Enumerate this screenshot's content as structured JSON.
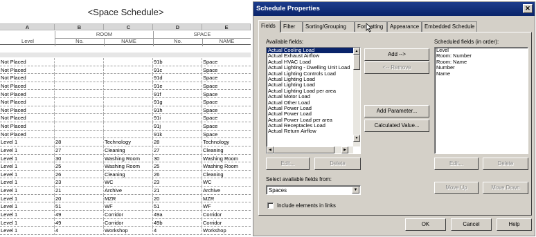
{
  "schedule": {
    "title": "<Space Schedule>",
    "column_letters": [
      "A",
      "B",
      "C",
      "D",
      "E"
    ],
    "group_headers": {
      "room": "ROOM",
      "space": "SPACE"
    },
    "columns": [
      "Level",
      "No.",
      "NAME",
      "No.",
      "NAME"
    ],
    "rows": [
      [
        "Not Placed",
        "",
        "",
        "91b",
        "Space"
      ],
      [
        "Not Placed",
        "",
        "",
        "91c",
        "Space"
      ],
      [
        "Not Placed",
        "",
        "",
        "91d",
        "Space"
      ],
      [
        "Not Placed",
        "",
        "",
        "91e",
        "Space"
      ],
      [
        "Not Placed",
        "",
        "",
        "91f",
        "Space"
      ],
      [
        "Not Placed",
        "",
        "",
        "91g",
        "Space"
      ],
      [
        "Not Placed",
        "",
        "",
        "91h",
        "Space"
      ],
      [
        "Not Placed",
        "",
        "",
        "91i",
        "Space"
      ],
      [
        "Not Placed",
        "",
        "",
        "91j",
        "Space"
      ],
      [
        "Not Placed",
        "",
        "",
        "91k",
        "Space"
      ],
      [
        "Level 1",
        "28",
        "Technology",
        "28",
        "Technology"
      ],
      [
        "Level 1",
        "27",
        "Cleaning",
        "27",
        "Cleaning"
      ],
      [
        "Level 1",
        "30",
        "Washing Room",
        "30",
        "Washing Room"
      ],
      [
        "Level 1",
        "25",
        "Washing Room",
        "25",
        "Washing Room"
      ],
      [
        "Level 1",
        "26",
        "Cleaning",
        "26",
        "Cleaning"
      ],
      [
        "Level 1",
        "23",
        "WC",
        "23",
        "WC"
      ],
      [
        "Level 1",
        "21",
        "Archive",
        "21",
        "Archive"
      ],
      [
        "Level 1",
        "20",
        "MZR",
        "20",
        "MZR"
      ],
      [
        "Level 1",
        "51",
        "WF",
        "51",
        "WF"
      ],
      [
        "Level 1",
        "49",
        "Corridor",
        "49a",
        "Corridor"
      ],
      [
        "Level 1",
        "49",
        "Corridor",
        "49b",
        "Corridor"
      ],
      [
        "Level 1",
        "4",
        "Workshop",
        "4",
        "Workshop"
      ]
    ]
  },
  "dialog": {
    "title": "Schedule Properties",
    "close_icon": "close-icon",
    "tabs": [
      "Fields",
      "Filter",
      "Sorting/Grouping",
      "Formatting",
      "Appearance",
      "Embedded Schedule"
    ],
    "active_tab": "Fields",
    "available_fields_label": "Available fields:",
    "available_fields": [
      "Actual Cooling Load",
      "Actual Exhaust Airflow",
      "Actual HVAC Load",
      "Actual Lighting - Dwelling Unit Load",
      "Actual Lighting Controls Load",
      "Actual Lighting Load",
      "Actual Lighting Load",
      "Actual Lighting Load per area",
      "Actual Motor Load",
      "Actual Other Load",
      "Actual Power Load",
      "Actual Power Load",
      "Actual Power Load per area",
      "Actual Receptacles Load",
      "Actual Return Airflow"
    ],
    "selected_available_field": "Actual Cooling Load",
    "scheduled_fields_label": "Scheduled fields (in order):",
    "scheduled_fields": [
      "Level",
      "Room: Number",
      "Room: Name",
      "Number",
      "Name"
    ],
    "buttons": {
      "add": "Add -->",
      "remove": "<-- Remove",
      "add_parameter": "Add Parameter...",
      "calculated_value": "Calculated Value...",
      "edit_left": "Edit...",
      "delete_left": "Delete",
      "edit_right": "Edit...",
      "delete_right": "Delete",
      "move_up": "Move Up",
      "move_down": "Move Down",
      "ok": "OK",
      "cancel": "Cancel",
      "help": "Help"
    },
    "select_fields_from_label": "Select available fields from:",
    "select_fields_from_value": "Spaces",
    "include_links_label": "Include elements in links",
    "include_links_checked": false
  }
}
